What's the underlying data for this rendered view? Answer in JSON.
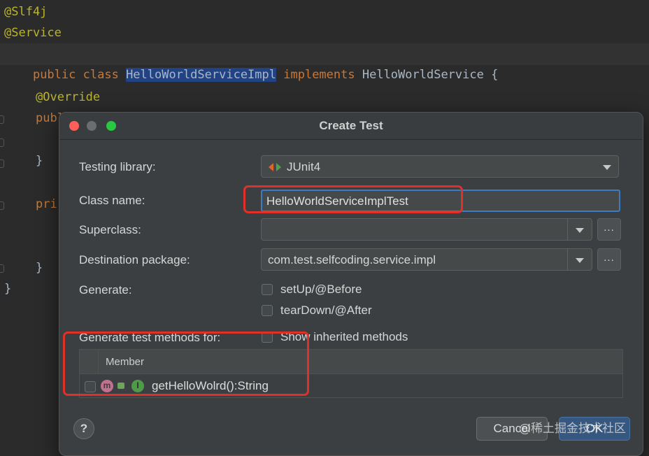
{
  "editor": {
    "line1": "@Slf4j",
    "line2": "@Service",
    "line3": {
      "public": "public",
      "class": "class",
      "classname": "HelloWorldServiceImpl",
      "implements": "implements",
      "iface": "HelloWorldService",
      "brace": " {"
    },
    "line5": "@Override",
    "line6": "publ",
    "line8": "}",
    "line10": "pri",
    "line12": "}",
    "line13": "}"
  },
  "dialog": {
    "title": "Create Test",
    "testing_library_label": "Testing library:",
    "testing_library_value": "JUnit4",
    "class_name_label": "Class name:",
    "class_name_value": "HelloWorldServiceImplTest",
    "superclass_label": "Superclass:",
    "superclass_value": "",
    "dest_package_label": "Destination package:",
    "dest_package_value": "com.test.selfcoding.service.impl",
    "browse_label": "...",
    "generate_label": "Generate:",
    "setup_label": "setUp/@Before",
    "teardown_label": "tearDown/@After",
    "generate_methods_label": "Generate test methods for:",
    "show_inherited_label": "Show inherited methods",
    "table_header_member": "Member",
    "methods": [
      {
        "m_badge": "m",
        "i_badge": "I",
        "signature": "getHelloWolrd():String"
      }
    ],
    "help_label": "?",
    "cancel_label": "Cancel",
    "ok_label": "OK"
  },
  "watermark": "@稀土掘金技术社区",
  "colors": {
    "editor_bg": "#2b2b2b",
    "dialog_bg": "#3c3f41",
    "highlight": "#e0302a",
    "selection": "#214283",
    "focus": "#3d7bc2"
  }
}
